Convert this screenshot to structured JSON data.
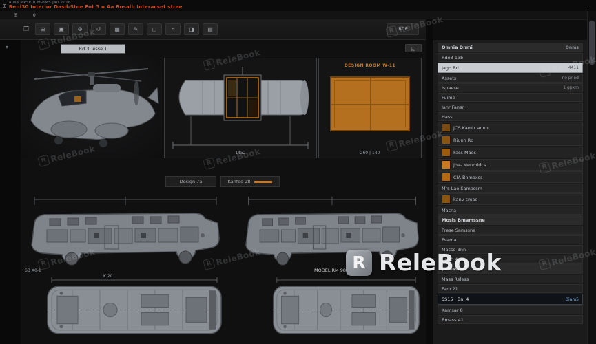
{
  "titlebar": {
    "icon": "⊕",
    "system_text": "A wa MPSEUCM-BMS Jau 2016",
    "title": "Re:d30 Interior Dasd-Stue Fot 3 u Aa Rosalb Interacset strae",
    "dots": "⋯"
  },
  "menubar": {
    "grid_icon": "⊞",
    "item": "0"
  },
  "toolbar": {
    "lead_icon": "❐",
    "buttons": [
      "⊞",
      "▣",
      "✥",
      "↺",
      "▦",
      "✎",
      "◻",
      "⌗",
      "◨",
      "▤"
    ],
    "right_button": "BCE"
  },
  "main": {
    "rail_icon": "▾",
    "chip_label": "Rd 3 Tesse 1",
    "expand_icon": "◱",
    "panelC_title": "DESIGN ROOM W-11",
    "cutaway_dim": "1452",
    "plan_dim": "260 | 140",
    "tab1": "Design 7a",
    "tab2": "Kanfee 28",
    "caption_left": "SB X0-1",
    "caption_note": "MODEL RM 98",
    "caption_top": "K 20"
  },
  "sidebar": {
    "rows": [
      {
        "kind": "header",
        "label": "Omnia Dnmi",
        "value": "Onms"
      },
      {
        "kind": "row",
        "label": "Rdo3 13b",
        "value": ""
      },
      {
        "kind": "input",
        "label": "Jago Rd",
        "value": "4411"
      },
      {
        "kind": "row",
        "label": "Assets",
        "value": "no pned"
      },
      {
        "kind": "row",
        "label": "Ispaese",
        "value": "1 gpxm"
      },
      {
        "kind": "row",
        "label": "Fuime",
        "value": ""
      },
      {
        "kind": "row",
        "label": "Janr Fansn",
        "value": ""
      },
      {
        "kind": "row",
        "label": "Hass",
        "value": ""
      },
      {
        "kind": "swatch",
        "swatch": "#7a4a12",
        "label": "JCS Kamtr anno",
        "value": ""
      },
      {
        "kind": "swatch",
        "swatch": "#8a5512",
        "label": "Riunn Rd",
        "value": ""
      },
      {
        "kind": "swatch",
        "swatch": "#9a5d0f",
        "label": "Fass Maes",
        "value": ""
      },
      {
        "kind": "swatch",
        "swatch": "#c87820",
        "label": "Jha- Menmidcs",
        "value": ""
      },
      {
        "kind": "swatch",
        "swatch": "#b06a14",
        "label": "CIA Bnmaxss",
        "value": ""
      },
      {
        "kind": "row",
        "label": "Mrs Lae Samassm",
        "value": ""
      },
      {
        "kind": "swatch",
        "swatch": "#8a5512",
        "label": "kanv smae-",
        "value": ""
      },
      {
        "kind": "row",
        "label": "Masna",
        "value": ""
      },
      {
        "kind": "header",
        "label": "Mosis Bmamssne",
        "value": ""
      },
      {
        "kind": "row",
        "label": "Prese Samssne",
        "value": ""
      },
      {
        "kind": "row",
        "label": "Fsama",
        "value": ""
      },
      {
        "kind": "row",
        "label": "Masse Bnn",
        "value": ""
      },
      {
        "kind": "row",
        "label": "Essm 4",
        "value": ""
      },
      {
        "kind": "header",
        "label": "Janessne",
        "value": ""
      },
      {
        "kind": "row",
        "label": "Mass Reless",
        "value": ""
      },
      {
        "kind": "row",
        "label": "Fam 21",
        "value": ""
      },
      {
        "kind": "inputdark",
        "label": "SS15 | Bnl 4",
        "value": "Diam5"
      },
      {
        "kind": "row",
        "label": "Kamsar 8",
        "value": ""
      },
      {
        "kind": "row",
        "label": "Bmass 41",
        "value": ""
      }
    ]
  },
  "watermark": {
    "logo_letter": "R",
    "text": "ReleBook"
  }
}
